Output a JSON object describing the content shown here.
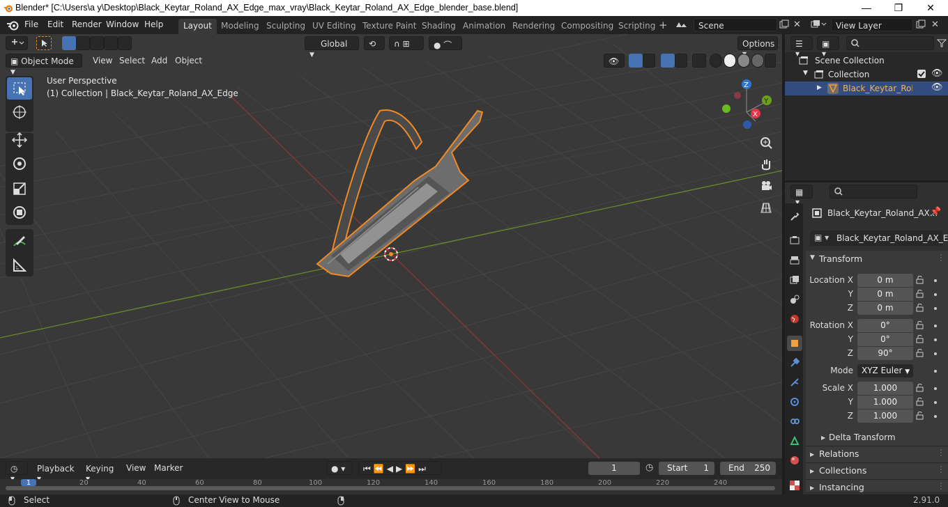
{
  "window": {
    "title": "Blender* [C:\\Users\\a y\\Desktop\\Black_Keytar_Roland_AX_Edge_max_vray\\Black_Keytar_Roland_AX_Edge_blender_base.blend]",
    "minimize": "—",
    "maximize": "❐",
    "close": "✕"
  },
  "menu": [
    "File",
    "Edit",
    "Render",
    "Window",
    "Help"
  ],
  "workspaces": [
    "Layout",
    "Modeling",
    "Sculpting",
    "UV Editing",
    "Texture Paint",
    "Shading",
    "Animation",
    "Rendering",
    "Compositing",
    "Scripting"
  ],
  "active_workspace": "Layout",
  "scene": {
    "name": "Scene",
    "view_layer": "View Layer"
  },
  "toolheader": {
    "orientation": "Global",
    "options": "Options"
  },
  "viewport_header": {
    "mode": "Object Mode",
    "menus": [
      "View",
      "Select",
      "Add",
      "Object"
    ]
  },
  "viewport": {
    "perspective": "User Perspective",
    "info": "(1) Collection | Black_Keytar_Roland_AX_Edge",
    "gizmo": {
      "x": "X",
      "y": "Y",
      "z": "Z"
    }
  },
  "outliner": {
    "root": "Scene Collection",
    "collection": "Collection",
    "object": "Black_Keytar_Roland"
  },
  "properties": {
    "object_name": "Black_Keytar_Roland_AX...",
    "data_name": "Black_Keytar_Roland_AX_E...",
    "transform": "Transform",
    "location_label": "Location X",
    "rotation_label": "Rotation X",
    "scale_label": "Scale X",
    "y_label": "Y",
    "z_label": "Z",
    "location": [
      "0 m",
      "0 m",
      "0 m"
    ],
    "rotation": [
      "0°",
      "0°",
      "90°"
    ],
    "mode_label": "Mode",
    "mode": "XYZ Euler",
    "scale": [
      "1.000",
      "1.000",
      "1.000"
    ],
    "sections": [
      "Delta Transform",
      "Relations",
      "Collections",
      "Instancing"
    ]
  },
  "timeline": {
    "menus": [
      "Playback",
      "Keying",
      "View",
      "Marker"
    ],
    "current_frame": "1",
    "start_label": "Start",
    "start": "1",
    "end_label": "End",
    "end": "250",
    "ruler": [
      "1",
      "20",
      "40",
      "60",
      "80",
      "100",
      "120",
      "140",
      "160",
      "180",
      "200",
      "220",
      "240"
    ]
  },
  "status": {
    "select": "Select",
    "center": "Center View to Mouse",
    "version": "2.91.0"
  }
}
